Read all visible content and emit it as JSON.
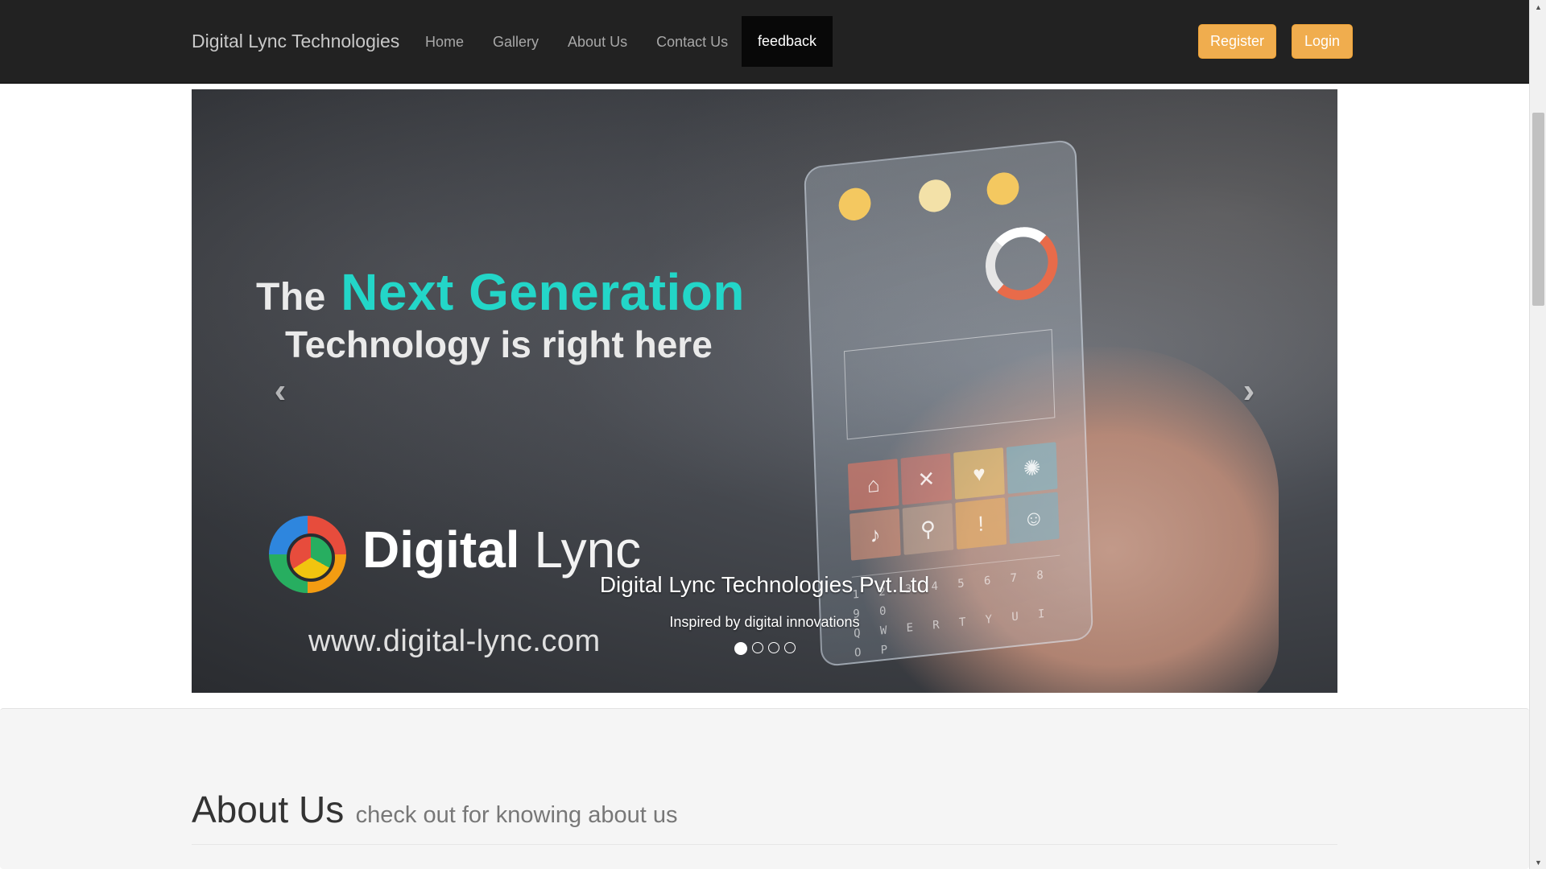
{
  "navbar": {
    "brand": "Digital Lync Technologies",
    "links": [
      "Home",
      "Gallery",
      "About Us",
      "Contact Us"
    ],
    "active_link": "feedback",
    "register_label": "Register",
    "login_label": "Login",
    "colors": {
      "background": "#222222",
      "button": "#f0ad4e",
      "active_bg": "#080808"
    }
  },
  "carousel": {
    "slide_image": {
      "headline_prefix": "The",
      "headline_accent": "Next Generation",
      "headline_line2": "Technology is right here",
      "logo_bold": "Digital",
      "logo_light": "Lync",
      "logo_url": "www.digital-lync.com",
      "keys_row1": "1 2 3 4 5 6 7 8 9 0",
      "keys_row2": "Q W E R T Y U I O P",
      "accent_color": "#23d6c8"
    },
    "caption_title": "Digital Lync Technologies Pvt.Ltd",
    "caption_subtitle": "Inspired by digital innovations",
    "indicator_count": 4,
    "active_index": 0,
    "prev_icon": "‹",
    "next_icon": "›"
  },
  "about": {
    "title": "About Us",
    "subtitle": "check out for knowing about us"
  },
  "scrollbar": {
    "up_icon": "▲",
    "down_icon": "▼"
  }
}
